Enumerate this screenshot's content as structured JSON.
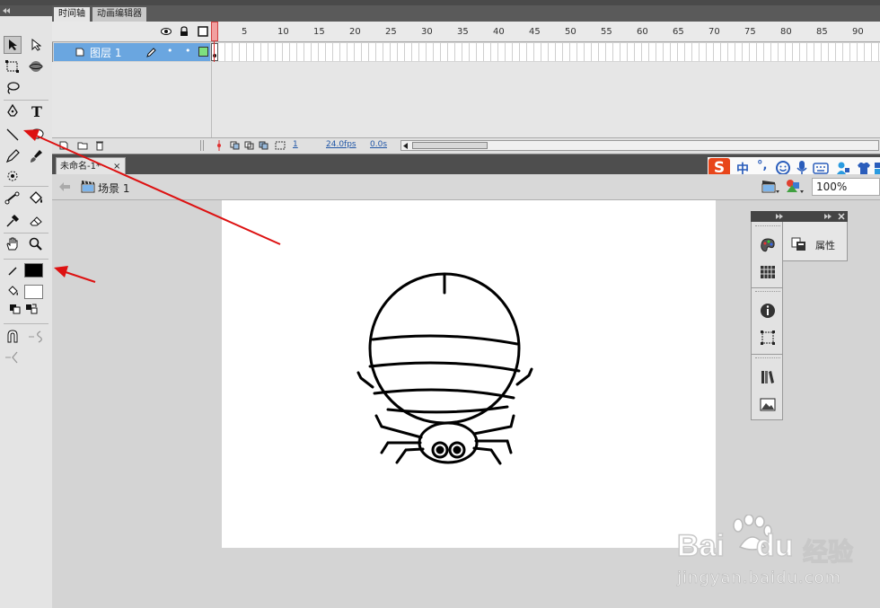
{
  "timeline": {
    "tabs": [
      "时间轴",
      "动画编辑器"
    ],
    "layer_name": "图层 1",
    "ruler": [
      "1",
      "5",
      "10",
      "15",
      "20",
      "25",
      "30",
      "35",
      "40",
      "45",
      "50",
      "55",
      "60",
      "65",
      "70",
      "75",
      "80",
      "85",
      "90"
    ],
    "status": {
      "frame": "1",
      "fps": "24.0fps",
      "time": "0.0s"
    }
  },
  "document": {
    "tab_label": "未命名-1*",
    "close_glyph": "×",
    "scene_label": "场景 1",
    "zoom": "100%"
  },
  "properties_panel": {
    "label": "属性"
  },
  "ime": {
    "zh": "中",
    "punct": "°,"
  },
  "watermark": {
    "brand": "Bai",
    "brand2": "du",
    "cn": "经验",
    "url": "jingyan.baidu.com"
  },
  "colors": {
    "stroke": "#000000",
    "fill": "#ffffff",
    "selection_row": "#6aa6e0",
    "playhead": "#e03030",
    "arrow": "#dd1111",
    "sogou": "#e8451a"
  }
}
